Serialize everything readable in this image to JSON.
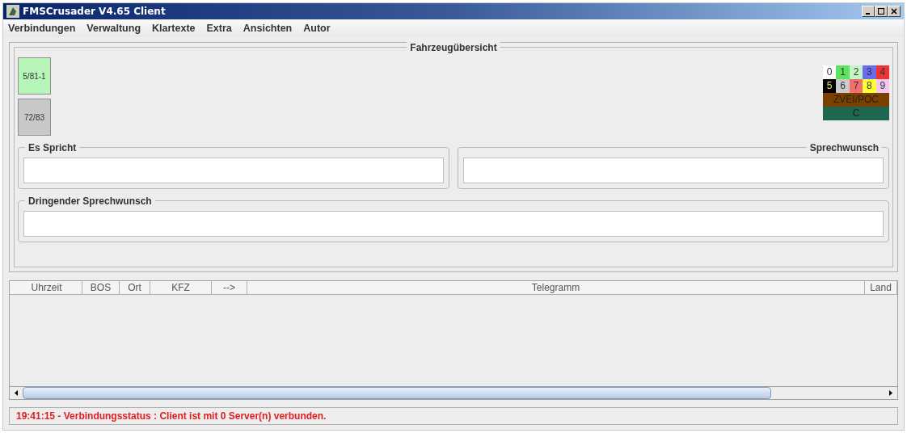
{
  "window": {
    "title": "FMSCrusader V4.65 Client"
  },
  "menu": [
    "Verbindungen",
    "Verwaltung",
    "Klartexte",
    "Extra",
    "Ansichten",
    "Autor"
  ],
  "overview": {
    "title": "Fahrzeugübersicht",
    "vehicles": [
      {
        "label": "5/81-1",
        "color": "#b8f5b8"
      },
      {
        "label": "72/83",
        "color": "#c8c8c8"
      }
    ],
    "legend_rows": [
      [
        {
          "label": "0",
          "color": "#ffffff"
        },
        {
          "label": "1",
          "color": "#5ee35e"
        },
        {
          "label": "2",
          "color": "#c5f5c5"
        },
        {
          "label": "3",
          "color": "#6b6bf0"
        },
        {
          "label": "4",
          "color": "#ee3333"
        }
      ],
      [
        {
          "label": "5",
          "color": "#000000"
        },
        {
          "label": "6",
          "color": "#cccccc"
        },
        {
          "label": "7",
          "color": "#f07070"
        },
        {
          "label": "8",
          "color": "#ffff33"
        },
        {
          "label": "9",
          "color": "#f0c8f0"
        }
      ],
      [
        {
          "label": "ZVEI/POC",
          "color": "#7a4000"
        }
      ],
      [
        {
          "label": "C",
          "color": "#1e6650"
        }
      ]
    ],
    "es_spricht": {
      "title": "Es Spricht"
    },
    "sprechwunsch": {
      "title": "Sprechwunsch"
    },
    "dringend": {
      "title": "Dringender Sprechwunsch"
    }
  },
  "table": {
    "columns": [
      "Uhrzeit",
      "BOS",
      "Ort",
      "KFZ",
      "-->",
      "Telegramm",
      "Land"
    ]
  },
  "status_bar": "19:41:15 - Verbindungsstatus : Client ist mit 0 Server(n) verbunden."
}
